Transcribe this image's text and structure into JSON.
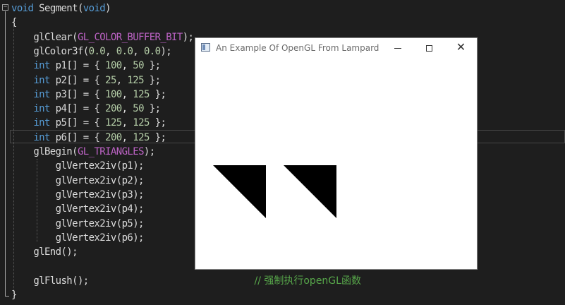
{
  "editor": {
    "fold_symbol": "−",
    "lines": [
      {
        "tokens": [
          {
            "t": "void",
            "c": "kw"
          },
          {
            "t": " Segment("
          },
          {
            "t": "void",
            "c": "kw"
          },
          {
            "t": ")"
          }
        ]
      },
      {
        "tokens": [
          {
            "t": "{"
          }
        ]
      },
      {
        "tokens": [
          {
            "t": "    glClear("
          },
          {
            "t": "GL_COLOR_BUFFER_BIT",
            "c": "mac"
          },
          {
            "t": ");"
          }
        ]
      },
      {
        "tokens": [
          {
            "t": "    glColor3f("
          },
          {
            "t": "0.0",
            "c": "num"
          },
          {
            "t": ", "
          },
          {
            "t": "0.0",
            "c": "num"
          },
          {
            "t": ", "
          },
          {
            "t": "0.0",
            "c": "num"
          },
          {
            "t": ");"
          }
        ]
      },
      {
        "tokens": [
          {
            "t": "    "
          },
          {
            "t": "int",
            "c": "kw"
          },
          {
            "t": " p1[] = { "
          },
          {
            "t": "100",
            "c": "num"
          },
          {
            "t": ", "
          },
          {
            "t": "50",
            "c": "num"
          },
          {
            "t": " };"
          }
        ]
      },
      {
        "tokens": [
          {
            "t": "    "
          },
          {
            "t": "int",
            "c": "kw"
          },
          {
            "t": " p2[] = { "
          },
          {
            "t": "25",
            "c": "num"
          },
          {
            "t": ", "
          },
          {
            "t": "125",
            "c": "num"
          },
          {
            "t": " };"
          }
        ]
      },
      {
        "tokens": [
          {
            "t": "    "
          },
          {
            "t": "int",
            "c": "kw"
          },
          {
            "t": " p3[] = { "
          },
          {
            "t": "100",
            "c": "num"
          },
          {
            "t": ", "
          },
          {
            "t": "125",
            "c": "num"
          },
          {
            "t": " };"
          }
        ]
      },
      {
        "tokens": [
          {
            "t": "    "
          },
          {
            "t": "int",
            "c": "kw"
          },
          {
            "t": " p4[] = { "
          },
          {
            "t": "200",
            "c": "num"
          },
          {
            "t": ", "
          },
          {
            "t": "50",
            "c": "num"
          },
          {
            "t": " };"
          }
        ]
      },
      {
        "tokens": [
          {
            "t": "    "
          },
          {
            "t": "int",
            "c": "kw"
          },
          {
            "t": " p5[] = { "
          },
          {
            "t": "125",
            "c": "num"
          },
          {
            "t": ", "
          },
          {
            "t": "125",
            "c": "num"
          },
          {
            "t": " };"
          }
        ]
      },
      {
        "tokens": [
          {
            "t": "    "
          },
          {
            "t": "int",
            "c": "kw"
          },
          {
            "t": " p6[] = { "
          },
          {
            "t": "200",
            "c": "num"
          },
          {
            "t": ", "
          },
          {
            "t": "125",
            "c": "num"
          },
          {
            "t": " };"
          }
        ]
      },
      {
        "tokens": [
          {
            "t": "    glBegin("
          },
          {
            "t": "GL_TRIANGLES",
            "c": "mac"
          },
          {
            "t": ");"
          }
        ]
      },
      {
        "tokens": [
          {
            "t": "        glVertex2iv(p1);"
          }
        ]
      },
      {
        "tokens": [
          {
            "t": "        glVertex2iv(p2);"
          }
        ]
      },
      {
        "tokens": [
          {
            "t": "        glVertex2iv(p3);"
          }
        ]
      },
      {
        "tokens": [
          {
            "t": "        glVertex2iv(p4);"
          }
        ]
      },
      {
        "tokens": [
          {
            "t": "        glVertex2iv(p5);"
          }
        ]
      },
      {
        "tokens": [
          {
            "t": "        glVertex2iv(p6);"
          }
        ]
      },
      {
        "tokens": [
          {
            "t": "    glEnd();"
          }
        ]
      },
      {
        "tokens": [
          {
            "t": ""
          }
        ]
      },
      {
        "tokens": [
          {
            "t": "    glFlush();"
          },
          {
            "t": "                              "
          },
          {
            "t": "// 强制执行openGL函数",
            "c": "cmt"
          }
        ]
      },
      {
        "tokens": [
          {
            "t": "}"
          }
        ]
      }
    ],
    "current_line_index": 9
  },
  "gl_window": {
    "title": "An Example Of OpenGL From Lampard",
    "fill_color": "#000000",
    "triangles": [
      [
        [
          100,
          50
        ],
        [
          25,
          125
        ],
        [
          100,
          125
        ]
      ],
      [
        [
          200,
          50
        ],
        [
          125,
          125
        ],
        [
          200,
          125
        ]
      ]
    ]
  }
}
